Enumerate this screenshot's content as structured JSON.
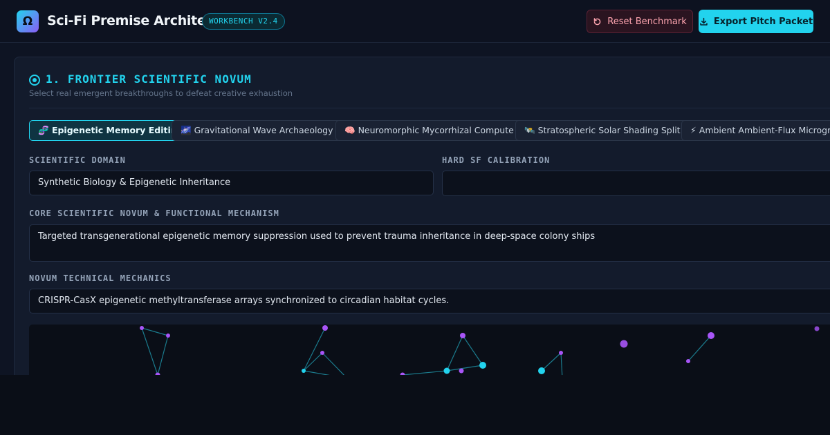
{
  "app": {
    "logo_glyph": "Ω",
    "title": "Sci-Fi Premise Architect",
    "version": "WORKBENCH V2.4"
  },
  "toolbar": {
    "reset_label": "Reset Benchmark",
    "export_label": "Export Pitch Packet"
  },
  "section": {
    "title": "1. FRONTIER SCIENTIFIC NOVUM",
    "subtitle": "Select real emergent breakthroughs to defeat creative exhaustion"
  },
  "chips": [
    {
      "icon": "🧬",
      "label": "Epigenetic Memory Editing",
      "active": true
    },
    {
      "icon": "🌌",
      "label": "Gravitational Wave Archaeology",
      "active": false
    },
    {
      "icon": "🧠",
      "label": "Neuromorphic Mycorrhizal Compute",
      "active": false
    },
    {
      "icon": "🛰️",
      "label": "Stratospheric Solar Shading Split",
      "active": false
    },
    {
      "icon": "⚡",
      "label": "Ambient Ambient-Flux Microgrid",
      "active": false
    }
  ],
  "fields": {
    "domain_label": "SCIENTIFIC DOMAIN",
    "domain_value": "Synthetic Biology & Epigenetic Inheritance",
    "calibration_label": "HARD SF CALIBRATION",
    "calibration_value": "",
    "novum_label": "CORE SCIENTIFIC NOVUM & FUNCTIONAL MECHANISM",
    "novum_value": "Targeted transgenerational epigenetic memory suppression used to prevent trauma inheritance in deep-space colony ships",
    "mechanics_label": "NOVUM TECHNICAL MECHANICS",
    "mechanics_value": "CRISPR-CasX epigenetic methyltransferase arrays synchronized to circadian habitat cycles."
  },
  "colors": {
    "accent": "#22d3ee",
    "node_violet": "#a855f7",
    "danger": "#fda4af"
  }
}
